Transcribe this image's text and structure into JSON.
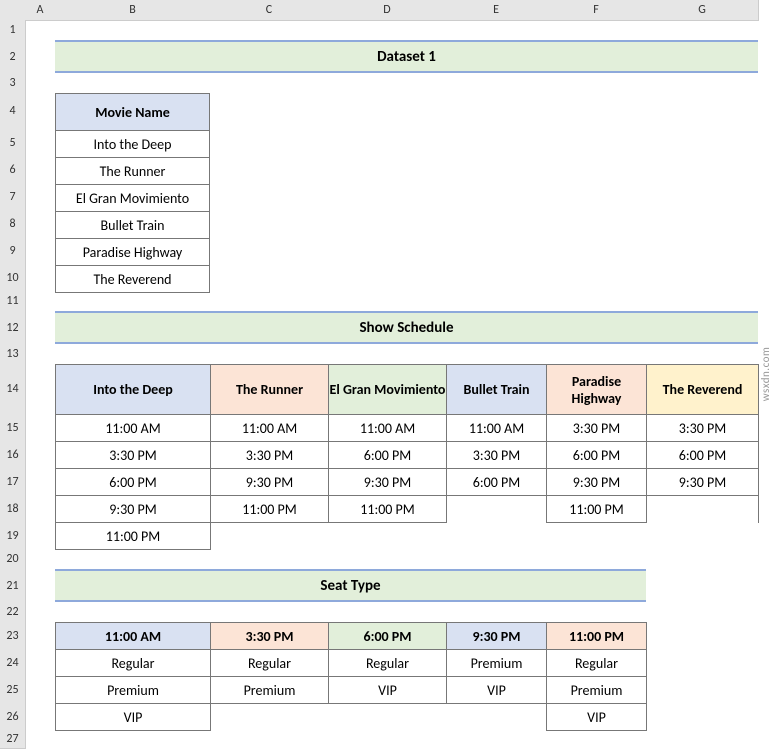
{
  "columns": [
    "A",
    "B",
    "C",
    "D",
    "E",
    "F",
    "G"
  ],
  "rows": [
    "1",
    "2",
    "3",
    "4",
    "5",
    "6",
    "7",
    "8",
    "9",
    "10",
    "11",
    "12",
    "13",
    "14",
    "15",
    "16",
    "17",
    "18",
    "19",
    "20",
    "21",
    "22",
    "23",
    "24",
    "25",
    "26",
    "27"
  ],
  "banners": {
    "dataset1": "Dataset 1",
    "schedule": "Show Schedule",
    "seattype": "Seat Type"
  },
  "movie_table": {
    "header": "Movie Name",
    "rows": [
      "Into the Deep",
      "The Runner",
      "El Gran Movimiento",
      "Bullet Train",
      "Paradise Highway",
      "The Reverend"
    ]
  },
  "schedule_table": {
    "headers": [
      "Into the Deep",
      "The Runner",
      "El Gran Movimiento",
      "Bullet Train",
      "Paradise Highway",
      "The Reverend"
    ],
    "rows": [
      [
        "11:00 AM",
        "11:00 AM",
        "11:00 AM",
        "11:00 AM",
        "3:30 PM",
        "3:30 PM"
      ],
      [
        "3:30 PM",
        "3:30 PM",
        "6:00 PM",
        "3:30 PM",
        "6:00 PM",
        "6:00 PM"
      ],
      [
        "6:00 PM",
        "9:30 PM",
        "9:30 PM",
        "6:00 PM",
        "9:30 PM",
        "9:30 PM"
      ],
      [
        "9:30 PM",
        "11:00 PM",
        "11:00 PM",
        "",
        "11:00 PM",
        ""
      ],
      [
        "11:00 PM",
        "",
        "",
        "",
        "",
        ""
      ]
    ]
  },
  "seat_table": {
    "headers": [
      "11:00 AM",
      "3:30 PM",
      "6:00 PM",
      "9:30 PM",
      "11:00 PM"
    ],
    "rows": [
      [
        "Regular",
        "Regular",
        "Regular",
        "Premium",
        "Regular"
      ],
      [
        "Premium",
        "Premium",
        "VIP",
        "VIP",
        "Premium"
      ],
      [
        "VIP",
        "",
        "",
        "",
        "VIP"
      ]
    ]
  },
  "watermark": "wsxdn.com"
}
